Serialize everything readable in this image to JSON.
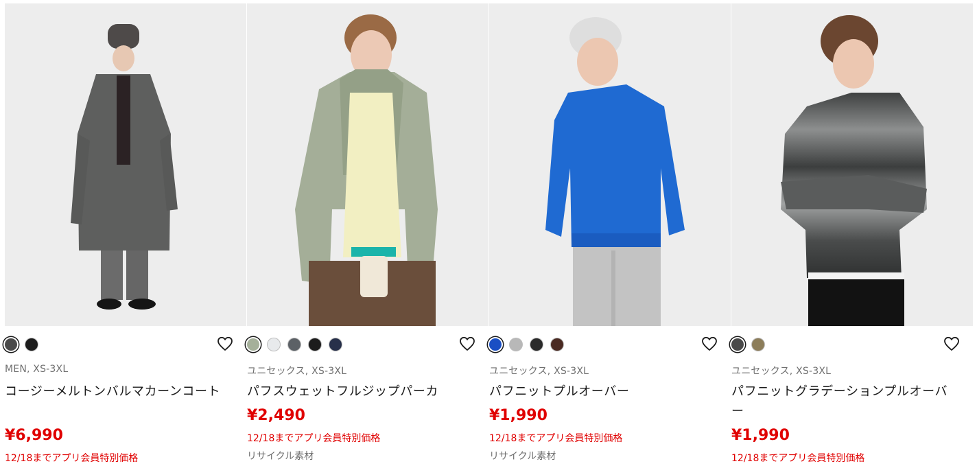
{
  "products": [
    {
      "photo_alt": "コージーメルトンバルマカーンコート",
      "swatches": [
        "#4a4a4a",
        "#1c1c1c"
      ],
      "meta": "MEN, XS-3XL",
      "name": "コージーメルトンバルマカーンコート",
      "price": "¥6,990",
      "promo": "12/18までアプリ会員特別価格",
      "feature": ""
    },
    {
      "photo_alt": "パフスウェットフルジップパーカ",
      "swatches": [
        "#a5b09a",
        "#e8eaec",
        "#5c6166",
        "#1c1c1c",
        "#27304a"
      ],
      "meta": "ユニセックス, XS-3XL",
      "name": "パフスウェットフルジップパーカ",
      "price": "¥2,490",
      "promo": "12/18までアプリ会員特別価格",
      "feature": "リサイクル素材"
    },
    {
      "photo_alt": "パフニットプルオーバー",
      "swatches": [
        "#1a4fc4",
        "#b8b8b8",
        "#2a2a2a",
        "#4a2a22"
      ],
      "meta": "ユニセックス, XS-3XL",
      "name": "パフニットプルオーバー",
      "price": "¥1,990",
      "promo": "12/18までアプリ会員特別価格",
      "feature": "リサイクル素材"
    },
    {
      "photo_alt": "パフニットグラデーションプルオーバー",
      "swatches": [
        "#4a4a4a",
        "#8c7d5a"
      ],
      "meta": "ユニセックス, XS-3XL",
      "name": "パフニットグラデーションプルオーバー",
      "price": "¥1,990",
      "promo": "12/18までアプリ会員特別価格",
      "feature": ""
    }
  ],
  "icons": {
    "favorite": "heart-outline-icon"
  },
  "colors": {
    "price": "#e00000",
    "meta": "#6f6f6f",
    "photo_bg": "#ededed"
  }
}
